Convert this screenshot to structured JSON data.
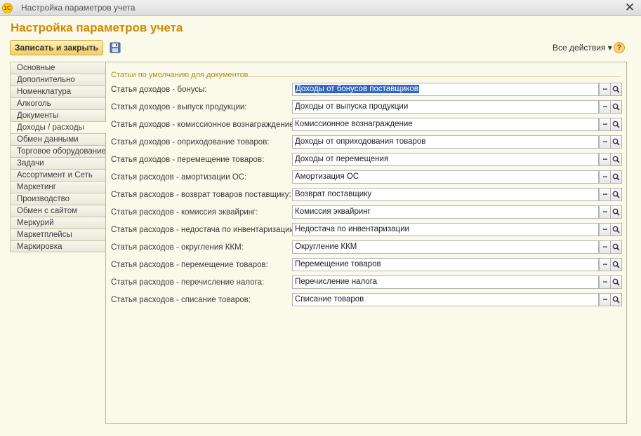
{
  "window": {
    "title": "Настройка параметров учета",
    "logo": "1С",
    "close_label": "✕"
  },
  "page": {
    "title": "Настройка параметров учета"
  },
  "toolbar": {
    "save_close_label": "Записать и закрыть",
    "save_icon": "floppy-disk-icon",
    "all_actions_label": "Все действия ▾",
    "help_label": "?"
  },
  "sidebar": {
    "active_index": 5,
    "items": [
      "Основные",
      "Дополнительно",
      "Номенклатура",
      "Алкоголь",
      "Документы",
      "Доходы / расходы",
      "Обмен данными",
      "Торговое оборудование",
      "Задачи",
      "Ассортимент и Сеть",
      "Маркетинг",
      "Производство",
      "Обмен с сайтом",
      "Меркурий",
      "Маркетплейсы",
      "Маркировка"
    ]
  },
  "group": {
    "title": "Статьи по умолчанию для документов"
  },
  "fields": [
    {
      "label": "Статья доходов - бонусы:",
      "value": "Доходы от бонусов поставщиков"
    },
    {
      "label": "Статья доходов - выпуск продукции:",
      "value": "Доходы от выпуска продукции"
    },
    {
      "label": "Статья доходов - комиссионное вознаграждение:",
      "value": "Комиссионное вознаграждение"
    },
    {
      "label": "Статья доходов - оприходование товаров:",
      "value": "Доходы от оприходования товаров"
    },
    {
      "label": "Статья доходов - перемещение товаров:",
      "value": "Доходы от перемещения"
    },
    {
      "label": "Статья расходов - амортизации ОС:",
      "value": "Амортизация ОС"
    },
    {
      "label": "Статья расходов - возврат товаров поставщику:",
      "value": "Возврат поставщику"
    },
    {
      "label": "Статья расходов - комиссия эквайринг:",
      "value": "Комиссия эквайринг"
    },
    {
      "label": "Статья расходов - недостача по инвентаризации:",
      "value": "Недостача по инвентаризации"
    },
    {
      "label": "Статья расходов - округления ККМ:",
      "value": "Округление ККМ"
    },
    {
      "label": "Статья расходов - перемещение товаров:",
      "value": "Перемещение товаров"
    },
    {
      "label": "Статья расходов - перечисление налога:",
      "value": "Перечисление налога"
    },
    {
      "label": "Статья расходов - списание товаров:",
      "value": "Списание товаров"
    }
  ],
  "field_buttons": {
    "select_label": "...",
    "search_icon": "magnifier-icon"
  },
  "colors": {
    "accent": "#cc8a00",
    "selection": "#3166c4"
  }
}
